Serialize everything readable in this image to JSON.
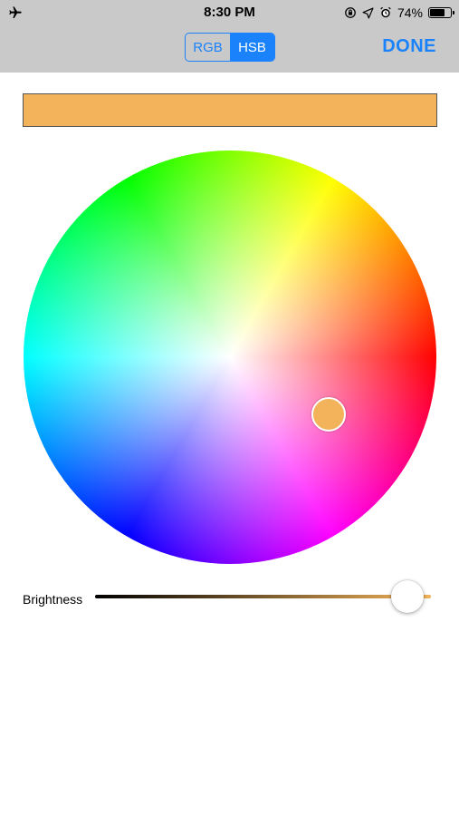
{
  "status_bar": {
    "time": "8:30 PM",
    "battery_percent": "74%",
    "battery_level": 0.74,
    "icons": [
      "airplane-icon",
      "orientation-lock-icon",
      "location-icon",
      "alarm-icon",
      "battery-icon"
    ]
  },
  "nav": {
    "segments": [
      {
        "label": "RGB",
        "selected": false
      },
      {
        "label": "HSB",
        "selected": true
      }
    ],
    "done_label": "DONE"
  },
  "colors": {
    "accent": "#1a82fb",
    "selected": "#f2b35a",
    "topbar": "#c9c9c9"
  },
  "picker": {
    "hue_degrees": 30,
    "saturation": 0.55,
    "brightness_label": "Brightness",
    "brightness": 0.93
  }
}
